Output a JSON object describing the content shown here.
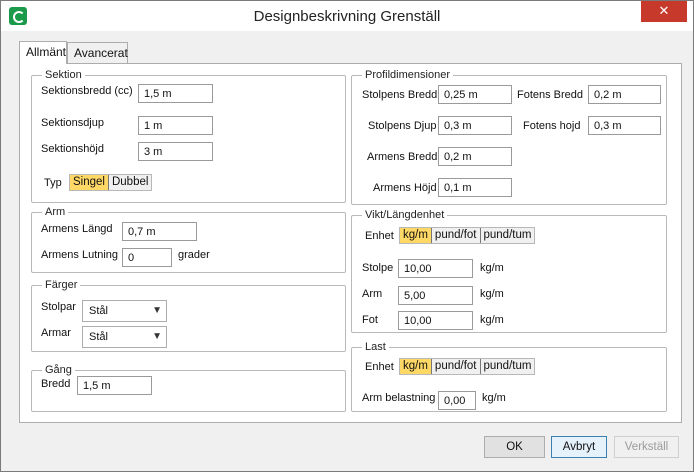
{
  "window": {
    "title": "Designbeskrivning Grenställ",
    "close_glyph": "✕"
  },
  "tabs": [
    {
      "label": "Allmänt"
    },
    {
      "label": "Avancerat"
    }
  ],
  "sektion": {
    "title": "Sektion",
    "bredd_label": "Sektionsbredd (cc)",
    "bredd_value": "1,5 m",
    "djup_label": "Sektionsdjup",
    "djup_value": "1 m",
    "hojd_label": "Sektionshöjd",
    "hojd_value": "3 m",
    "typ_label": "Typ",
    "typ_options": [
      "Singel",
      "Dubbel"
    ],
    "typ_selected": "Singel"
  },
  "arm": {
    "title": "Arm",
    "langd_label": "Armens Längd",
    "langd_value": "0,7 m",
    "lutning_label": "Armens Lutning",
    "lutning_value": "0",
    "lutning_unit": "grader"
  },
  "farger": {
    "title": "Färger",
    "stolpar_label": "Stolpar",
    "stolpar_value": "Stål",
    "armar_label": "Armar",
    "armar_value": "Stål"
  },
  "gang": {
    "title": "Gång",
    "bredd_label": "Bredd",
    "bredd_value": "1,5 m"
  },
  "profil": {
    "title": "Profildimensioner",
    "stolpens_bredd_label": "Stolpens Bredd",
    "stolpens_bredd_value": "0,25 m",
    "fotens_bredd_label": "Fotens Bredd",
    "fotens_bredd_value": "0,2 m",
    "stolpens_djup_label": "Stolpens Djup",
    "stolpens_djup_value": "0,3 m",
    "fotens_hojd_label": "Fotens hojd",
    "fotens_hojd_value": "0,3 m",
    "armens_bredd_label": "Armens Bredd",
    "armens_bredd_value": "0,2 m",
    "armens_hojd_label": "Armens Höjd",
    "armens_hojd_value": "0,1 m"
  },
  "vikt": {
    "title": "Vikt/Längdenhet",
    "enhet_label": "Enhet",
    "enhet_options": [
      "kg/m",
      "pund/fot",
      "pund/tum"
    ],
    "enhet_selected": "kg/m",
    "stolpe_label": "Stolpe",
    "stolpe_value": "10,00",
    "stolpe_unit": "kg/m",
    "arm_label": "Arm",
    "arm_value": "5,00",
    "arm_unit": "kg/m",
    "fot_label": "Fot",
    "fot_value": "10,00",
    "fot_unit": "kg/m"
  },
  "last": {
    "title": "Last",
    "enhet_label": "Enhet",
    "enhet_options": [
      "kg/m",
      "pund/fot",
      "pund/tum"
    ],
    "enhet_selected": "kg/m",
    "arm_belastning_label": "Arm belastning",
    "arm_belastning_value": "0,00",
    "arm_belastning_unit": "kg/m"
  },
  "buttons": {
    "ok": "OK",
    "cancel": "Avbryt",
    "apply": "Verkställ"
  }
}
